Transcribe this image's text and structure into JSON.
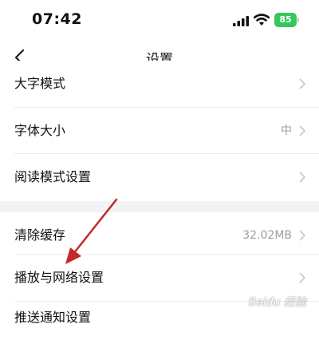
{
  "status_bar": {
    "time": "07:42",
    "battery": "85",
    "battery_color": "#34c759",
    "signal_icon": "cellular-signal-icon",
    "wifi_icon": "wifi-icon"
  },
  "nav": {
    "title": "设置",
    "back_icon": "chevron-left-icon"
  },
  "settings": {
    "group1": [
      {
        "label": "大字模式",
        "value": ""
      },
      {
        "label": "字体大小",
        "value": "中"
      },
      {
        "label": "阅读模式设置",
        "value": ""
      }
    ],
    "group2": [
      {
        "label": "清除缓存",
        "value": "32.02MB"
      },
      {
        "label": "播放与网络设置",
        "value": ""
      },
      {
        "label": "推送通知设置",
        "value": ""
      }
    ]
  },
  "annotation": {
    "arrow_color": "#c62828"
  },
  "watermark": "Baidu 经验"
}
